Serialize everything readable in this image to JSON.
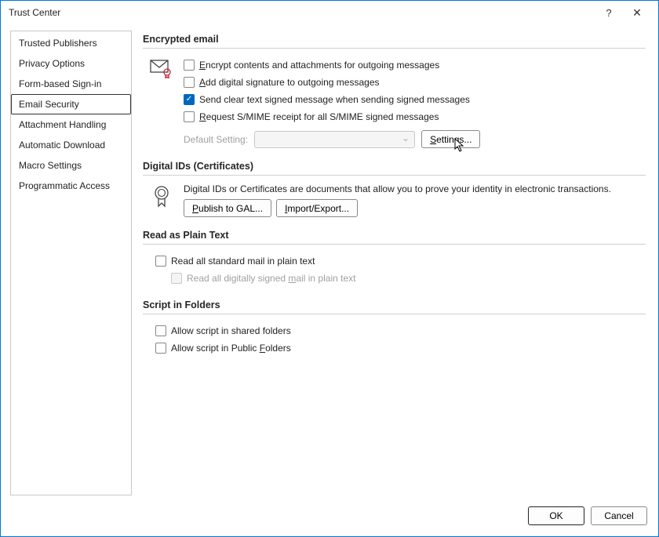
{
  "title": "Trust Center",
  "sidebar": {
    "items": [
      "Trusted Publishers",
      "Privacy Options",
      "Form-based Sign-in",
      "Email Security",
      "Attachment Handling",
      "Automatic Download",
      "Macro Settings",
      "Programmatic Access"
    ],
    "selected_index": 3
  },
  "sections": {
    "encrypted": {
      "title": "Encrypted email",
      "opt_encrypt": "ncrypt contents and attachments for outgoing messages",
      "opt_sig": "dd digital signature to outgoing messages",
      "opt_clear": "Send clear text signed message when sending signed messages",
      "opt_receipt_pre": "equest S/MIME receipt for all S/MIME signed messages",
      "default_label": "Default Setting:",
      "settings_btn": "ettings..."
    },
    "digital_ids": {
      "title": "Digital IDs (Certificates)",
      "desc": "Digital IDs or Certificates are documents that allow you to prove your identity in electronic transactions.",
      "publish_btn": "ublish to GAL...",
      "import_btn": "mport/Export..."
    },
    "plain": {
      "title": "Read as Plain Text",
      "opt_all": "Read all standard mail in plain text",
      "opt_signed_pre": "Read all digitally signed ",
      "opt_signed_post": "ail in plain text"
    },
    "script": {
      "title": "Script in Folders",
      "opt_shared": "Allow script in shared folders",
      "opt_public_pre": "Allow script in Public ",
      "opt_public_post": "olders"
    }
  },
  "footer": {
    "ok": "OK",
    "cancel": "Cancel"
  }
}
